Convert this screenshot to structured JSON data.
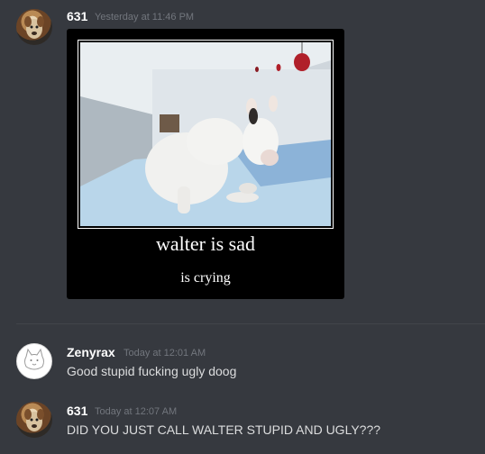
{
  "messages": [
    {
      "username": "631",
      "timestamp": "Yesterday at 11:46 PM",
      "avatar_icon": "dog-avatar-icon",
      "attachment": {
        "title": "walter is sad",
        "subtitle": "is crying"
      }
    },
    {
      "username": "Zenyrax",
      "timestamp": "Today at 12:01 AM",
      "avatar_icon": "cat-avatar-icon",
      "text": "Good stupid fucking ugly doog"
    },
    {
      "username": "631",
      "timestamp": "Today at 12:07 AM",
      "avatar_icon": "dog-avatar-icon",
      "text": "DID YOU JUST CALL WALTER STUPID AND UGLY???"
    }
  ],
  "colors": {
    "background": "#36393f",
    "username": "#ffffff",
    "timestamp": "#72767d",
    "message_text": "#dcddde"
  }
}
